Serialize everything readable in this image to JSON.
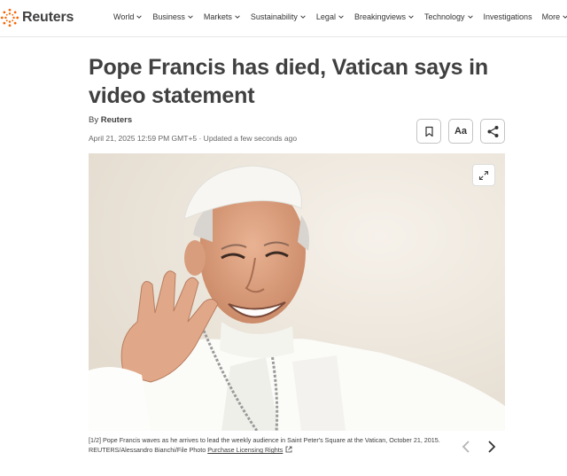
{
  "brand": {
    "name": "Reuters",
    "accent": "#fa6400"
  },
  "nav": {
    "items": [
      {
        "label": "World",
        "has_dropdown": true
      },
      {
        "label": "Business",
        "has_dropdown": true
      },
      {
        "label": "Markets",
        "has_dropdown": true
      },
      {
        "label": "Sustainability",
        "has_dropdown": true
      },
      {
        "label": "Legal",
        "has_dropdown": true
      },
      {
        "label": "Breakingviews",
        "has_dropdown": true
      },
      {
        "label": "Technology",
        "has_dropdown": true
      },
      {
        "label": "Investigations",
        "has_dropdown": false
      },
      {
        "label": "More",
        "has_dropdown": true
      }
    ]
  },
  "article": {
    "headline": "Pope Francis has died, Vatican says in video statement",
    "byline_prefix": "By",
    "author": "Reuters",
    "dateline": "April 21, 2025 12:59 PM GMT+5 · Updated a few seconds ago",
    "tools": {
      "text_size_label": "Aa"
    }
  },
  "photo": {
    "counter": "[1/2]",
    "caption": "Pope Francis waves as he arrives to lead the weekly audience in Saint Peter's Square at the Vatican, October 21, 2015. REUTERS/Alessandro Bianchi/File Photo",
    "license_link": "Purchase Licensing Rights"
  }
}
